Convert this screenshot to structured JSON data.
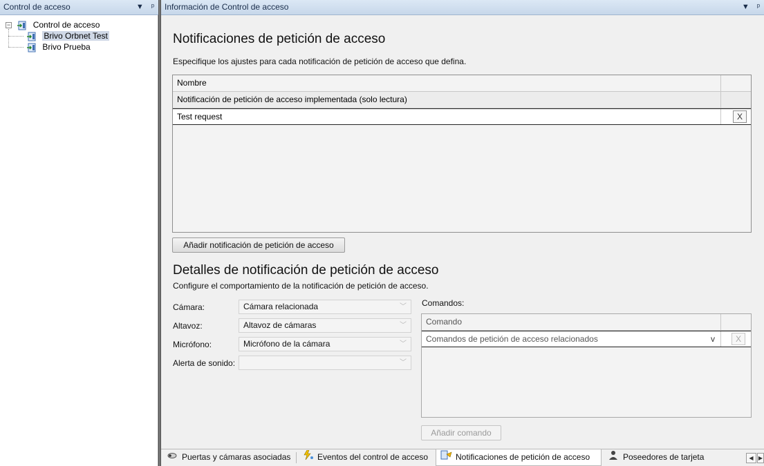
{
  "left_pane": {
    "title": "Control de acceso",
    "tree": {
      "root": "Control de acceso",
      "children": [
        "Brivo Orbnet Test",
        "Brivo Prueba"
      ],
      "selected": "Brivo Orbnet Test"
    }
  },
  "right_pane": {
    "title": "Información de Control de acceso"
  },
  "requests": {
    "heading": "Notificaciones de petición de acceso",
    "description": "Especifique los ajustes para cada notificación de petición de acceso que defina.",
    "column_header": "Nombre",
    "rows": [
      "Notificación de petición de acceso implementada (solo lectura)",
      "Test request"
    ],
    "delete_label": "X",
    "add_button": "Añadir notificación de petición de acceso"
  },
  "details": {
    "heading": "Detalles de notificación de petición de acceso",
    "description": "Configure el comportamiento de la notificación de petición de acceso.",
    "camera_label": "Cámara:",
    "camera_value": "Cámara relacionada",
    "speaker_label": "Altavoz:",
    "speaker_value": "Altavoz de cámaras",
    "mic_label": "Micrófono:",
    "mic_value": "Micrófono de la cámara",
    "sound_label": "Alerta de sonido:",
    "sound_value": ""
  },
  "commands": {
    "label": "Comandos:",
    "column_header": "Comando",
    "row": "Comandos de petición de acceso relacionados",
    "row_arrow": "v",
    "delete_label": "X",
    "add_button": "Añadir comando"
  },
  "tabs": [
    "Puertas y cámaras asociadas",
    "Eventos del control de acceso",
    "Notificaciones de petición de acceso",
    "Poseedores de tarjeta"
  ],
  "active_tab": "Notificaciones de petición de acceso"
}
